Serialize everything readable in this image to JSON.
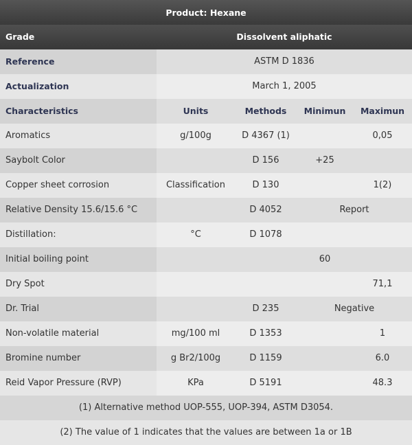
{
  "title": "Product: Hexane",
  "grade": {
    "label": "Grade",
    "value": "Dissolvent aliphatic"
  },
  "reference": {
    "label": "Reference",
    "value": "ASTM D 1836"
  },
  "actualization": {
    "label": "Actualization",
    "value": "March 1, 2005"
  },
  "header": {
    "characteristics": "Characteristics",
    "units": "Units",
    "methods": "Methods",
    "minimun": "Minimun",
    "maximun": "Maximun"
  },
  "rows": [
    {
      "name": "Aromatics",
      "units": "g/100g",
      "method": "D 4367 (1)",
      "min": "",
      "max": "0,05",
      "span": ""
    },
    {
      "name": "Saybolt Color",
      "units": "",
      "method": "D 156",
      "min": "+25",
      "max": "",
      "span": ""
    },
    {
      "name": "Copper sheet corrosion",
      "units": "Classification",
      "method": "D 130",
      "min": "",
      "max": "1(2)",
      "span": ""
    },
    {
      "name": "Relative Density 15.6/15.6 °C",
      "units": "",
      "method": "D 4052",
      "min": "",
      "max": "",
      "span": "Report"
    },
    {
      "name": "Distillation:",
      "units": "°C",
      "method": "D 1078",
      "min": "",
      "max": "",
      "span": ""
    },
    {
      "name": "Initial boiling point",
      "units": "",
      "method": "",
      "min": "60",
      "max": "",
      "span": ""
    },
    {
      "name": "Dry Spot",
      "units": "",
      "method": "",
      "min": "",
      "max": "71,1",
      "span": ""
    },
    {
      "name": "Dr. Trial",
      "units": "",
      "method": "D 235",
      "min": "",
      "max": "",
      "span": "Negative"
    },
    {
      "name": "Non-volatile material",
      "units": "mg/100 ml",
      "method": "D 1353",
      "min": "",
      "max": "1",
      "span": ""
    },
    {
      "name": "Bromine number",
      "units": "g Br2/100g",
      "method": "D 1159",
      "min": "",
      "max": "6.0",
      "span": ""
    },
    {
      "name": "Reid Vapor Pressure (RVP)",
      "units": "KPa",
      "method": "D 5191",
      "min": "",
      "max": "48.3",
      "span": ""
    }
  ],
  "notes": [
    "(1) Alternative method UOP-555, UOP-394, ASTM D3054.",
    "(2) The value of 1 indicates that the values are between 1a or 1B"
  ]
}
